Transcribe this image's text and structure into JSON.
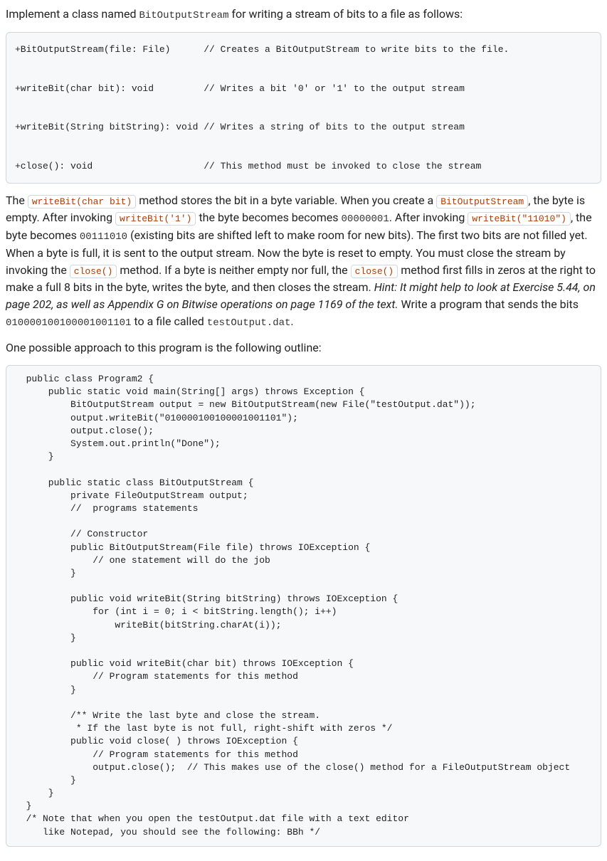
{
  "intro": {
    "prefix": "Implement a class named ",
    "className": "BitOutputStream",
    "suffix": " for writing a stream of bits to a file as follows:"
  },
  "apiBlock": "+BitOutputStream(file: File)      // Creates a BitOutputStream to write bits to the file.\n\n+writeBit(char bit): void         // Writes a bit '0' or '1' to the output stream\n\n+writeBit(String bitString): void // Writes a string of bits to the output stream\n\n+close(): void                    // This method must be invoked to close the stream",
  "para2": {
    "t1": "The ",
    "c1": "writeBit(char bit)",
    "t2": " method stores the bit in a byte variable. When you create a ",
    "c2": "BitOutputStream",
    "t3": ", the byte is empty. After invoking ",
    "c3": "writeBit('1')",
    "t4": " the byte becomes becomes ",
    "c4": "00000001",
    "t5": ". After invoking ",
    "c5": "writeBit(\"11010\")",
    "t6": ", the byte becomes ",
    "c6": "00111010",
    "t7": " (existing bits are shifted left to make room for new bits). The first two bits are not filled yet. When a byte is full, it is sent to the output stream. Now the byte is reset to empty. You must close the stream by invoking the ",
    "c7": "close()",
    "t8": " method. If a byte is neither empty nor full, the ",
    "c8": "close()",
    "t9": " method first fills in zeros at the right to make a full 8 bits in the byte, writes the byte, and then closes the stream. ",
    "hint": "Hint: It might help to look at Exercise 5.44, on page 202, as well as Appendix G on Bitwise operations on page 1169 of the text.",
    "t10": " Write a program that sends the bits ",
    "c9": "010000100100001001101",
    "t11": " to a file called ",
    "c10": "testOutput.dat",
    "t12": "."
  },
  "para3": "One possible approach to this program is the following outline:",
  "codeBlock": "  public class Program2 {\n      public static void main(String[] args) throws Exception {\n          BitOutputStream output = new BitOutputStream(new File(\"testOutput.dat\"));\n          output.writeBit(\"010000100100001001101\");\n          output.close();\n          System.out.println(\"Done\");\n      }\n\n      public static class BitOutputStream {\n          private FileOutputStream output;\n          //  programs statements\n\n          // Constructor\n          public BitOutputStream(File file) throws IOException {\n              // one statement will do the job\n          }\n\n          public void writeBit(String bitString) throws IOException {\n              for (int i = 0; i < bitString.length(); i++)\n                  writeBit(bitString.charAt(i));\n          }\n\n          public void writeBit(char bit) throws IOException {\n              // Program statements for this method\n          }\n\n          /** Write the last byte and close the stream.\n           * If the last byte is not full, right-shift with zeros */\n          public void close( ) throws IOException {\n              // Program statements for this method\n              output.close();  // This makes use of the close() method for a FileOutputStream object\n          }\n      }\n  }\n  /* Note that when you open the testOutput.dat file with a text editor\n     like Notepad, you should see the following: BBh */"
}
